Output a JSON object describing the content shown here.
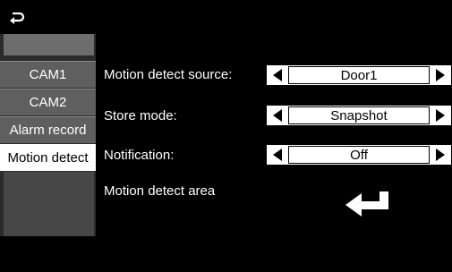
{
  "sidebar": {
    "items": [
      {
        "label": "CAM1"
      },
      {
        "label": "CAM2"
      },
      {
        "label": "Alarm record"
      },
      {
        "label": "Motion detect"
      }
    ]
  },
  "settings": {
    "source": {
      "label": "Motion detect source:",
      "value": "Door1"
    },
    "store": {
      "label": "Store mode:",
      "value": "Snapshot"
    },
    "notification": {
      "label": "Notification:",
      "value": "Off"
    },
    "area": {
      "label": "Motion detect area"
    }
  },
  "icons": {
    "back": "return-arrow-icon",
    "enter": "enter-return-icon",
    "prev": "triangle-left-icon",
    "next": "triangle-right-icon"
  },
  "colors": {
    "background": "#000000",
    "selector": "#ffffff",
    "selected_tab": "#ffffff"
  }
}
